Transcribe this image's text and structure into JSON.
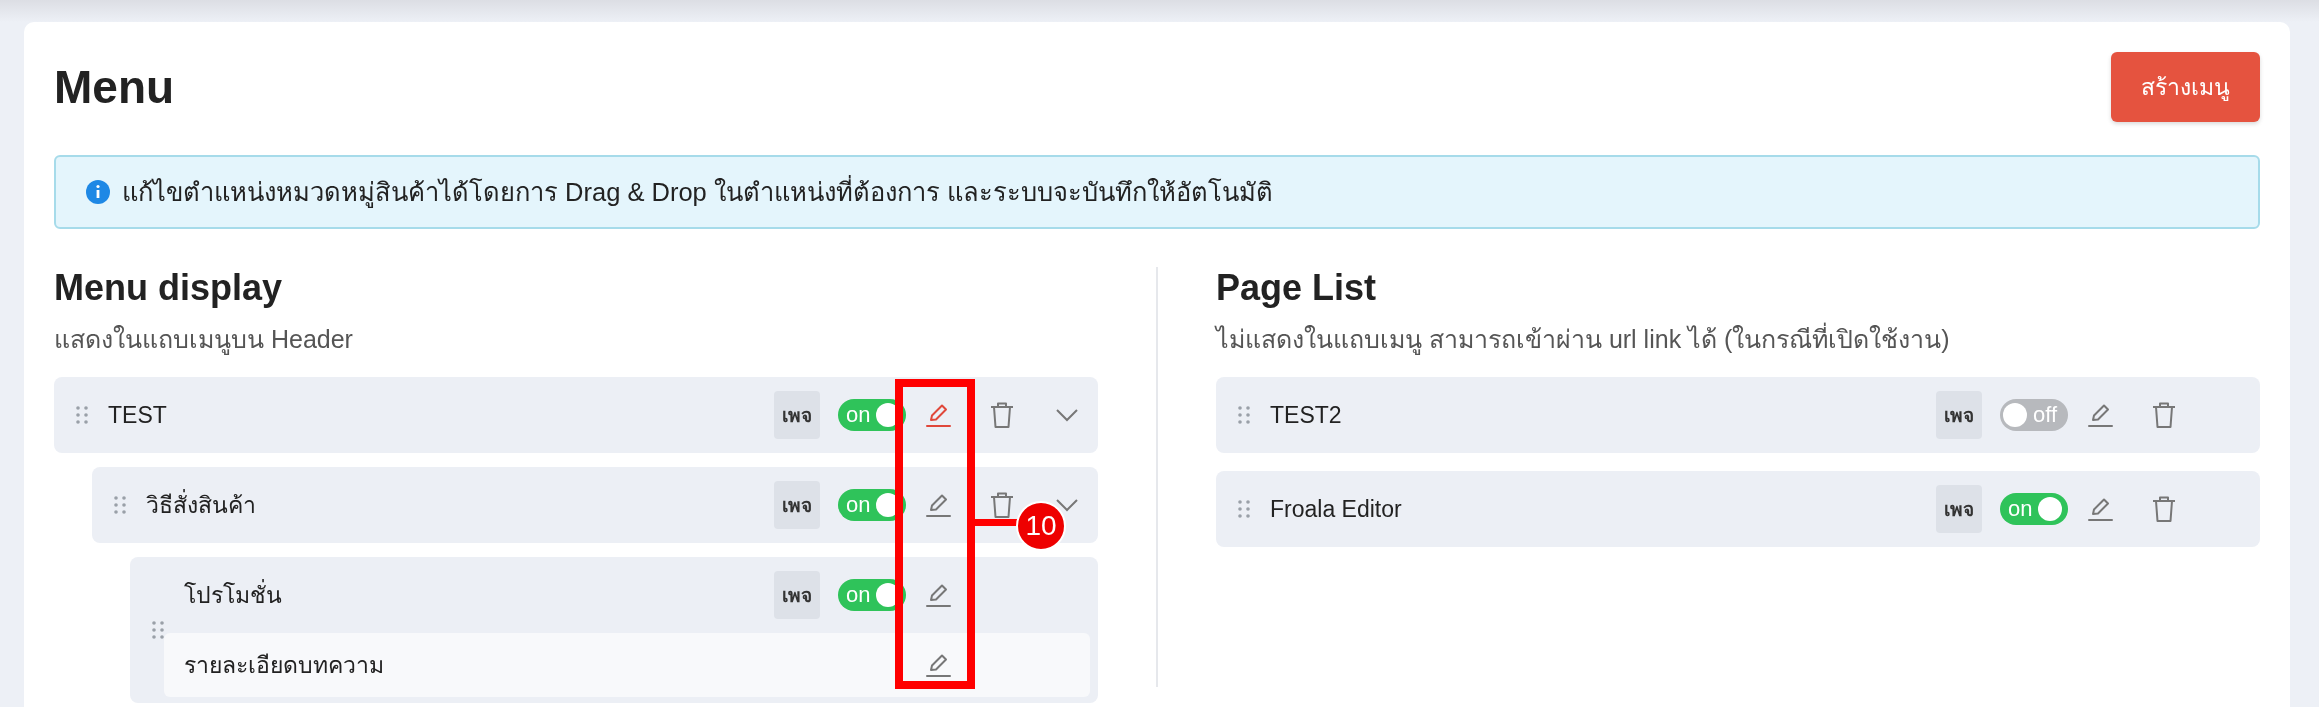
{
  "page": {
    "title": "Menu",
    "create_button": "สร้างเมนู"
  },
  "notice": {
    "text": "แก้ไขตำแหน่งหมวดหมู่สินค้าได้โดยการ Drag & Drop ในตำแหน่งที่ต้องการ และระบบจะบันทึกให้อัตโนมัติ"
  },
  "menu_display": {
    "title": "Menu display",
    "subtitle": "แสดงในแถบเมนูบน Header",
    "items": [
      {
        "kind": "menu",
        "label": "TEST",
        "badge": "เพจ",
        "toggle": {
          "on": true,
          "label": "on"
        },
        "edit_active": true,
        "deletable": true,
        "expandable": true,
        "children": [
          {
            "kind": "menu",
            "label": "วิธีสั่งสินค้า",
            "badge": "เพจ",
            "toggle": {
              "on": true,
              "label": "on"
            },
            "edit_active": false,
            "deletable": true,
            "expandable": true,
            "children": [
              {
                "kind": "menu",
                "label": "โปรโมชั่น",
                "badge": "เพจ",
                "toggle": {
                  "on": true,
                  "label": "on"
                },
                "edit_active": false,
                "deletable": false,
                "expandable": false,
                "children": [
                  {
                    "kind": "content",
                    "label": "รายละเอียดบทความ",
                    "edit_active": false
                  }
                ]
              }
            ]
          }
        ]
      }
    ]
  },
  "page_list": {
    "title": "Page List",
    "subtitle": "ไม่แสดงในแถบเมนู สามารถเข้าผ่าน url link ได้ (ในกรณีที่เปิดใช้งาน)",
    "items": [
      {
        "kind": "menu",
        "label": "TEST2",
        "badge": "เพจ",
        "toggle": {
          "on": false,
          "label": "off"
        },
        "edit_active": false,
        "deletable": true,
        "expandable": false
      },
      {
        "kind": "menu",
        "label": "Froala Editor",
        "badge": "เพจ",
        "toggle": {
          "on": true,
          "label": "on"
        },
        "edit_active": false,
        "deletable": true,
        "expandable": false
      }
    ]
  },
  "annotation": {
    "label": "10"
  }
}
